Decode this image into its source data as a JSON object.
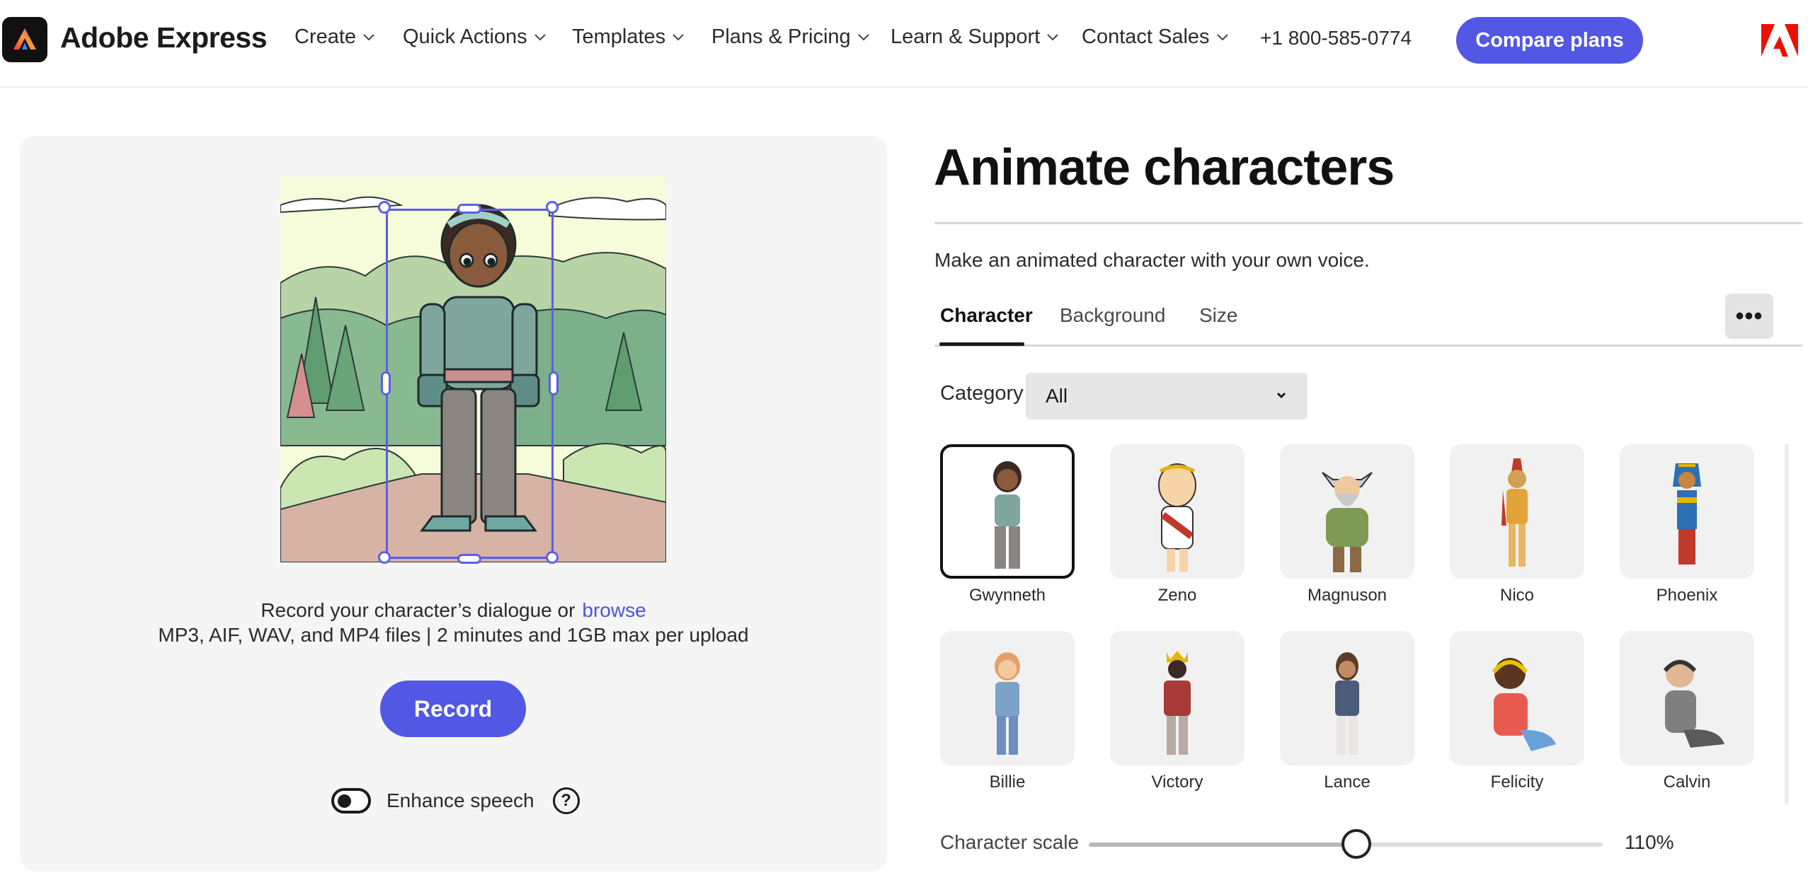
{
  "header": {
    "brand": "Adobe Express",
    "nav": [
      {
        "label": "Create"
      },
      {
        "label": "Quick Actions"
      },
      {
        "label": "Templates"
      },
      {
        "label": "Plans & Pricing"
      },
      {
        "label": "Learn & Support"
      },
      {
        "label": "Contact Sales"
      }
    ],
    "phone": "+1 800-585-0774",
    "cta": "Compare plans"
  },
  "preview": {
    "record_prompt": "Record your character’s dialogue or",
    "browse_link": "browse",
    "file_note": "MP3, AIF, WAV, and MP4 files | 2 minutes and 1GB max per upload",
    "record_button": "Record",
    "enhance_label": "Enhance speech",
    "enhance_on": true,
    "help_glyph": "?"
  },
  "panel": {
    "title": "Animate characters",
    "subtitle": "Make an animated character with your own voice.",
    "tabs": [
      {
        "label": "Character",
        "active": true
      },
      {
        "label": "Background",
        "active": false
      },
      {
        "label": "Size",
        "active": false
      }
    ],
    "more_glyph": "•••",
    "category_label": "Category",
    "category_value": "All",
    "characters": [
      {
        "name": "Gwynneth",
        "selected": true
      },
      {
        "name": "Zeno",
        "selected": false
      },
      {
        "name": "Magnuson",
        "selected": false
      },
      {
        "name": "Nico",
        "selected": false
      },
      {
        "name": "Phoenix",
        "selected": false
      },
      {
        "name": "Billie",
        "selected": false
      },
      {
        "name": "Victory",
        "selected": false
      },
      {
        "name": "Lance",
        "selected": false
      },
      {
        "name": "Felicity",
        "selected": false
      },
      {
        "name": "Calvin",
        "selected": false
      }
    ],
    "scale_label": "Character scale",
    "scale_value": "110%",
    "scale_fraction": 0.52
  },
  "colors": {
    "accent": "#5258e4",
    "adobe_red": "#eb1000"
  }
}
